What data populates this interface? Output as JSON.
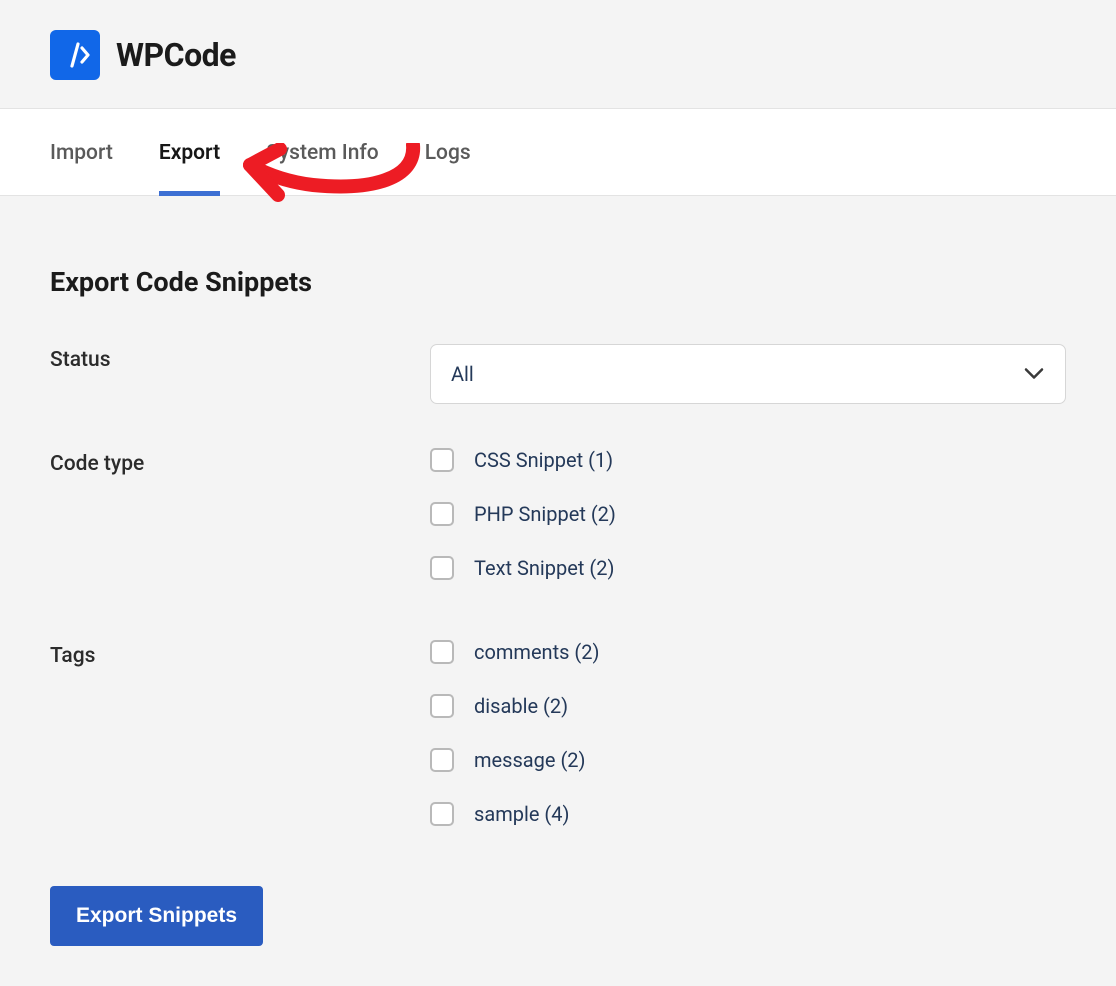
{
  "brand": "WPCode",
  "tabs": [
    {
      "label": "Import",
      "active": false
    },
    {
      "label": "Export",
      "active": true
    },
    {
      "label": "System Info",
      "active": false
    },
    {
      "label": "Logs",
      "active": false
    }
  ],
  "page": {
    "title": "Export Code Snippets"
  },
  "form": {
    "status": {
      "label": "Status",
      "selected": "All"
    },
    "code_type": {
      "label": "Code type",
      "options": [
        {
          "label": "CSS Snippet (1)"
        },
        {
          "label": "PHP Snippet (2)"
        },
        {
          "label": "Text Snippet (2)"
        }
      ]
    },
    "tags": {
      "label": "Tags",
      "options": [
        {
          "label": "comments (2)"
        },
        {
          "label": "disable (2)"
        },
        {
          "label": "message (2)"
        },
        {
          "label": "sample (4)"
        }
      ]
    },
    "submit_label": "Export Snippets"
  },
  "colors": {
    "brand_blue": "#1167e8",
    "tab_accent": "#3c6fd3",
    "text_body": "#243959",
    "button_bg": "#2a5cc0",
    "annotation_red": "#ed1c24"
  }
}
